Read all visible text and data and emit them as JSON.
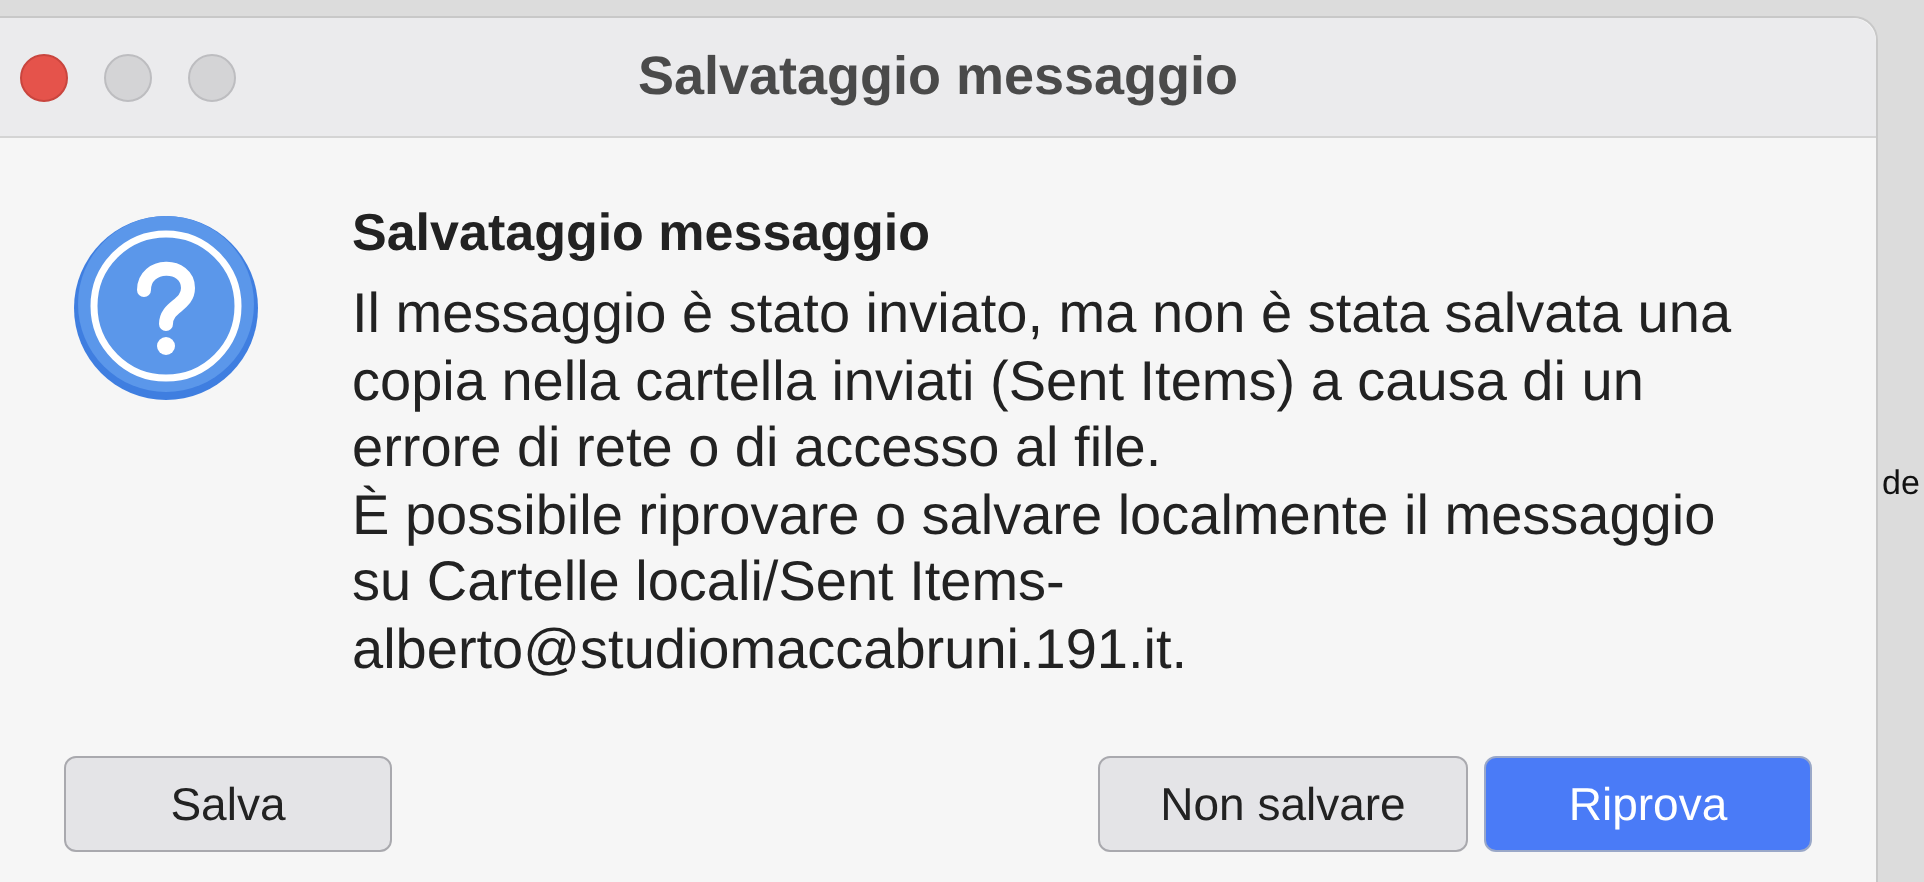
{
  "window": {
    "title": "Salvataggio messaggio"
  },
  "dialog": {
    "heading": "Salvataggio messaggio",
    "paragraphs": [
      "Il messaggio è stato inviato, ma non è stata salvata una copia nella cartella inviati (Sent Items) a causa di un errore di rete o di accesso al file.",
      "È possibile riprovare o salvare localmente il messaggio su Cartelle locali/Sent Items-alberto@studiomaccabruni.191.it."
    ],
    "buttons": [
      {
        "label": "Salva",
        "kind": "secondary"
      },
      {
        "label": "Non salvare",
        "kind": "secondary"
      },
      {
        "label": "Riprova",
        "kind": "default"
      }
    ]
  },
  "background": {
    "text": "de"
  }
}
